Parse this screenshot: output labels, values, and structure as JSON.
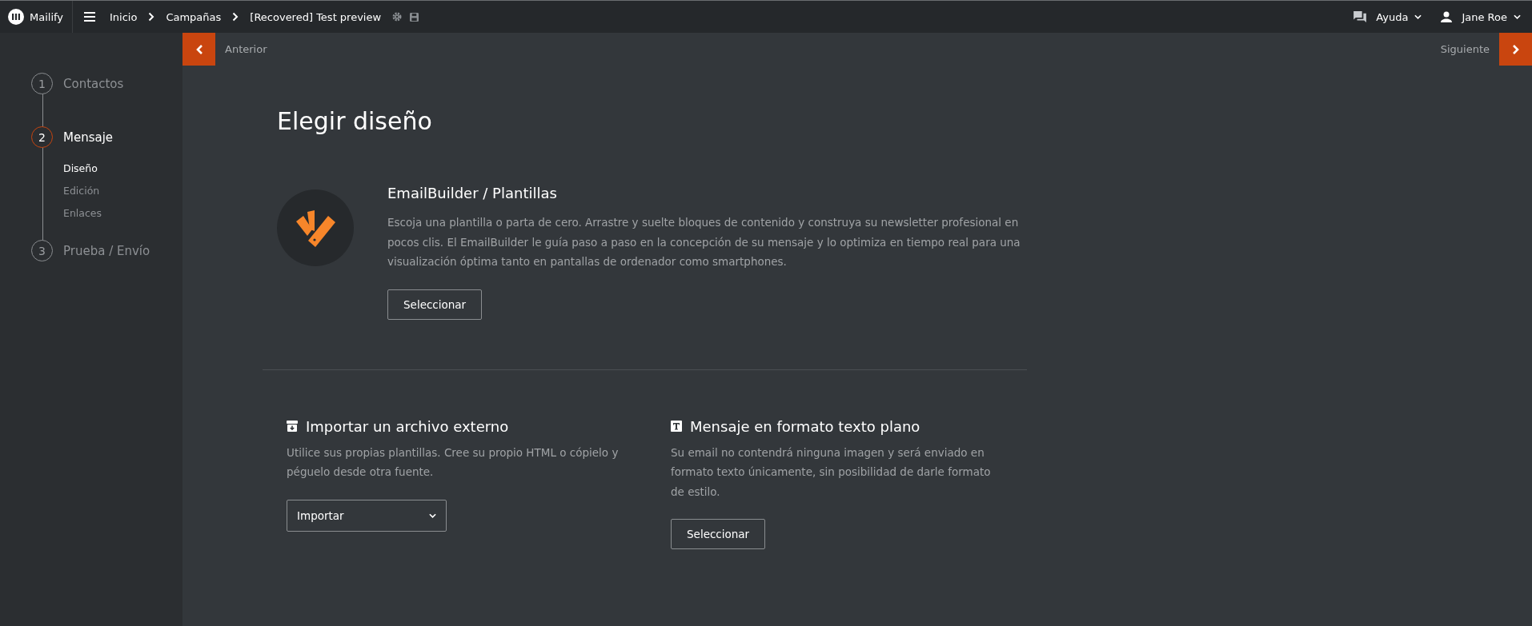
{
  "topbar": {
    "brand": "Mailify",
    "breadcrumb": [
      "Inicio",
      "Campañas",
      "[Recovered] Test preview"
    ],
    "help": "Ayuda",
    "user": "Jane Roe"
  },
  "nav": {
    "previous": "Anterior",
    "next": "Siguiente"
  },
  "steps": [
    {
      "number": "1",
      "label": "Contactos",
      "selected": false
    },
    {
      "number": "2",
      "label": "Mensaje",
      "selected": true,
      "substeps": [
        {
          "label": "Diseño",
          "selected": true
        },
        {
          "label": "Edición",
          "selected": false
        },
        {
          "label": "Enlaces",
          "selected": false
        }
      ]
    },
    {
      "number": "3",
      "label": "Prueba / Envío",
      "selected": false
    }
  ],
  "page_title": "Elegir diseño",
  "builder": {
    "title": "EmailBuilder / Plantillas",
    "description": "Escoja una plantilla o parta de cero. Arrastre y suelte bloques de contenido y construya su newsletter profesional en pocos clis. El EmailBuilder le guía paso a paso en la concepción de su mensaje y lo optimiza en tiempo real para una visualización óptima tanto en pantallas de ordenador como smartphones.",
    "button": "Seleccionar"
  },
  "options": [
    {
      "kind": "import",
      "title": "Importar un archivo externo",
      "description": "Utilice sus propias plantillas. Cree su propio HTML o cópielo y péguelo desde otra fuente.",
      "control": "Importar"
    },
    {
      "kind": "plaintext",
      "title": "Mensaje en formato texto plano",
      "description": "Su email no contendrá ninguna imagen y será enviado en formato texto únicamente, sin posibilidad de darle formato de estilo.",
      "control": "Seleccionar"
    }
  ]
}
